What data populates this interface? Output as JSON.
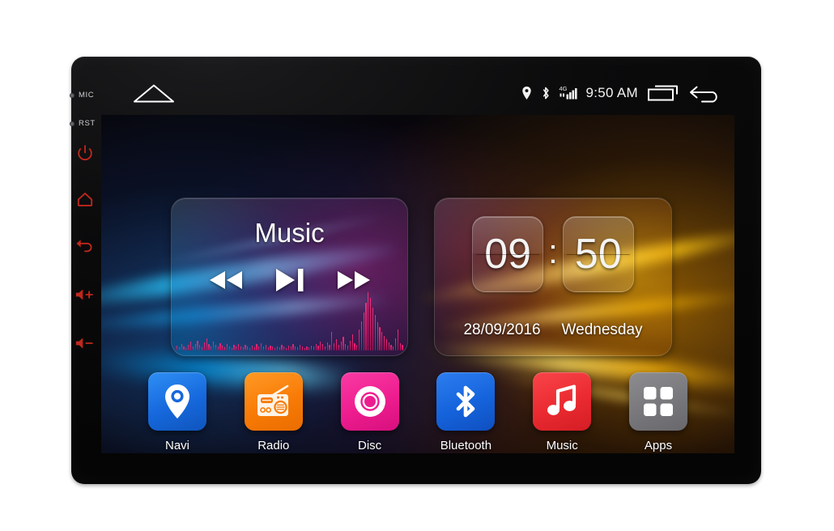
{
  "device": {
    "indicators": [
      {
        "name": "mic",
        "label": "MIC"
      },
      {
        "name": "rst",
        "label": "RST"
      }
    ],
    "hard_keys": [
      {
        "name": "power",
        "label": "power"
      },
      {
        "name": "home",
        "label": "home"
      },
      {
        "name": "back",
        "label": "back"
      },
      {
        "name": "volume-up",
        "label": "volume up"
      },
      {
        "name": "volume-down",
        "label": "volume down"
      }
    ],
    "bezel_color": "#0a0a0b",
    "key_color": "#c0271c"
  },
  "statusbar": {
    "home_icon": "home-pentagon-icon",
    "icons": [
      {
        "name": "location-icon",
        "label": "location"
      },
      {
        "name": "bluetooth-icon",
        "label": "bluetooth"
      },
      {
        "name": "signal-4g-icon",
        "label": "4G"
      }
    ],
    "network_label": "4G",
    "clock": "9:50 AM",
    "recents_icon": "recents-icon",
    "back_icon": "back-arrow-icon"
  },
  "widgets": {
    "music": {
      "title": "Music",
      "controls": [
        {
          "name": "previous",
          "glyph": "rewind"
        },
        {
          "name": "play-pause",
          "glyph": "play-pause"
        },
        {
          "name": "next",
          "glyph": "fast-forward"
        }
      ],
      "equalizer_levels": [
        8,
        5,
        11,
        7,
        4,
        9,
        14,
        6,
        10,
        16,
        9,
        5,
        13,
        20,
        11,
        7,
        15,
        9,
        6,
        12,
        8,
        5,
        10,
        7,
        4,
        9,
        6,
        11,
        7,
        5,
        9,
        6,
        4,
        8,
        5,
        10,
        7,
        12,
        6,
        9,
        5,
        8,
        6,
        4,
        7,
        5,
        9,
        6,
        4,
        8,
        6,
        10,
        7,
        5,
        9,
        6,
        4,
        7,
        5,
        8,
        6,
        11,
        8,
        14,
        10,
        7,
        13,
        9,
        30,
        12,
        18,
        9,
        14,
        22,
        11,
        8,
        16,
        26,
        12,
        9,
        34,
        48,
        62,
        78,
        96,
        86,
        70,
        58,
        46,
        38,
        30,
        24,
        18,
        13,
        9,
        7,
        20,
        34,
        12,
        9
      ]
    },
    "clock": {
      "hours": "09",
      "separator": ":",
      "minutes": "50",
      "date": "28/09/2016",
      "weekday": "Wednesday"
    }
  },
  "dock": {
    "apps": [
      {
        "name": "navi",
        "label": "Navi",
        "icon": "map-pin-icon",
        "color": "#1668dc"
      },
      {
        "name": "radio",
        "label": "Radio",
        "icon": "radio-icon",
        "color": "#f87b06"
      },
      {
        "name": "disc",
        "label": "Disc",
        "icon": "disc-icon",
        "color": "#ee1d8f"
      },
      {
        "name": "bluetooth",
        "label": "Bluetooth",
        "icon": "bluetooth-icon",
        "color": "#1563dc"
      },
      {
        "name": "music",
        "label": "Music",
        "icon": "music-note-icon",
        "color": "#ea2a30"
      },
      {
        "name": "apps",
        "label": "Apps",
        "icon": "grid-apps-icon",
        "color": "#78787c"
      }
    ]
  }
}
